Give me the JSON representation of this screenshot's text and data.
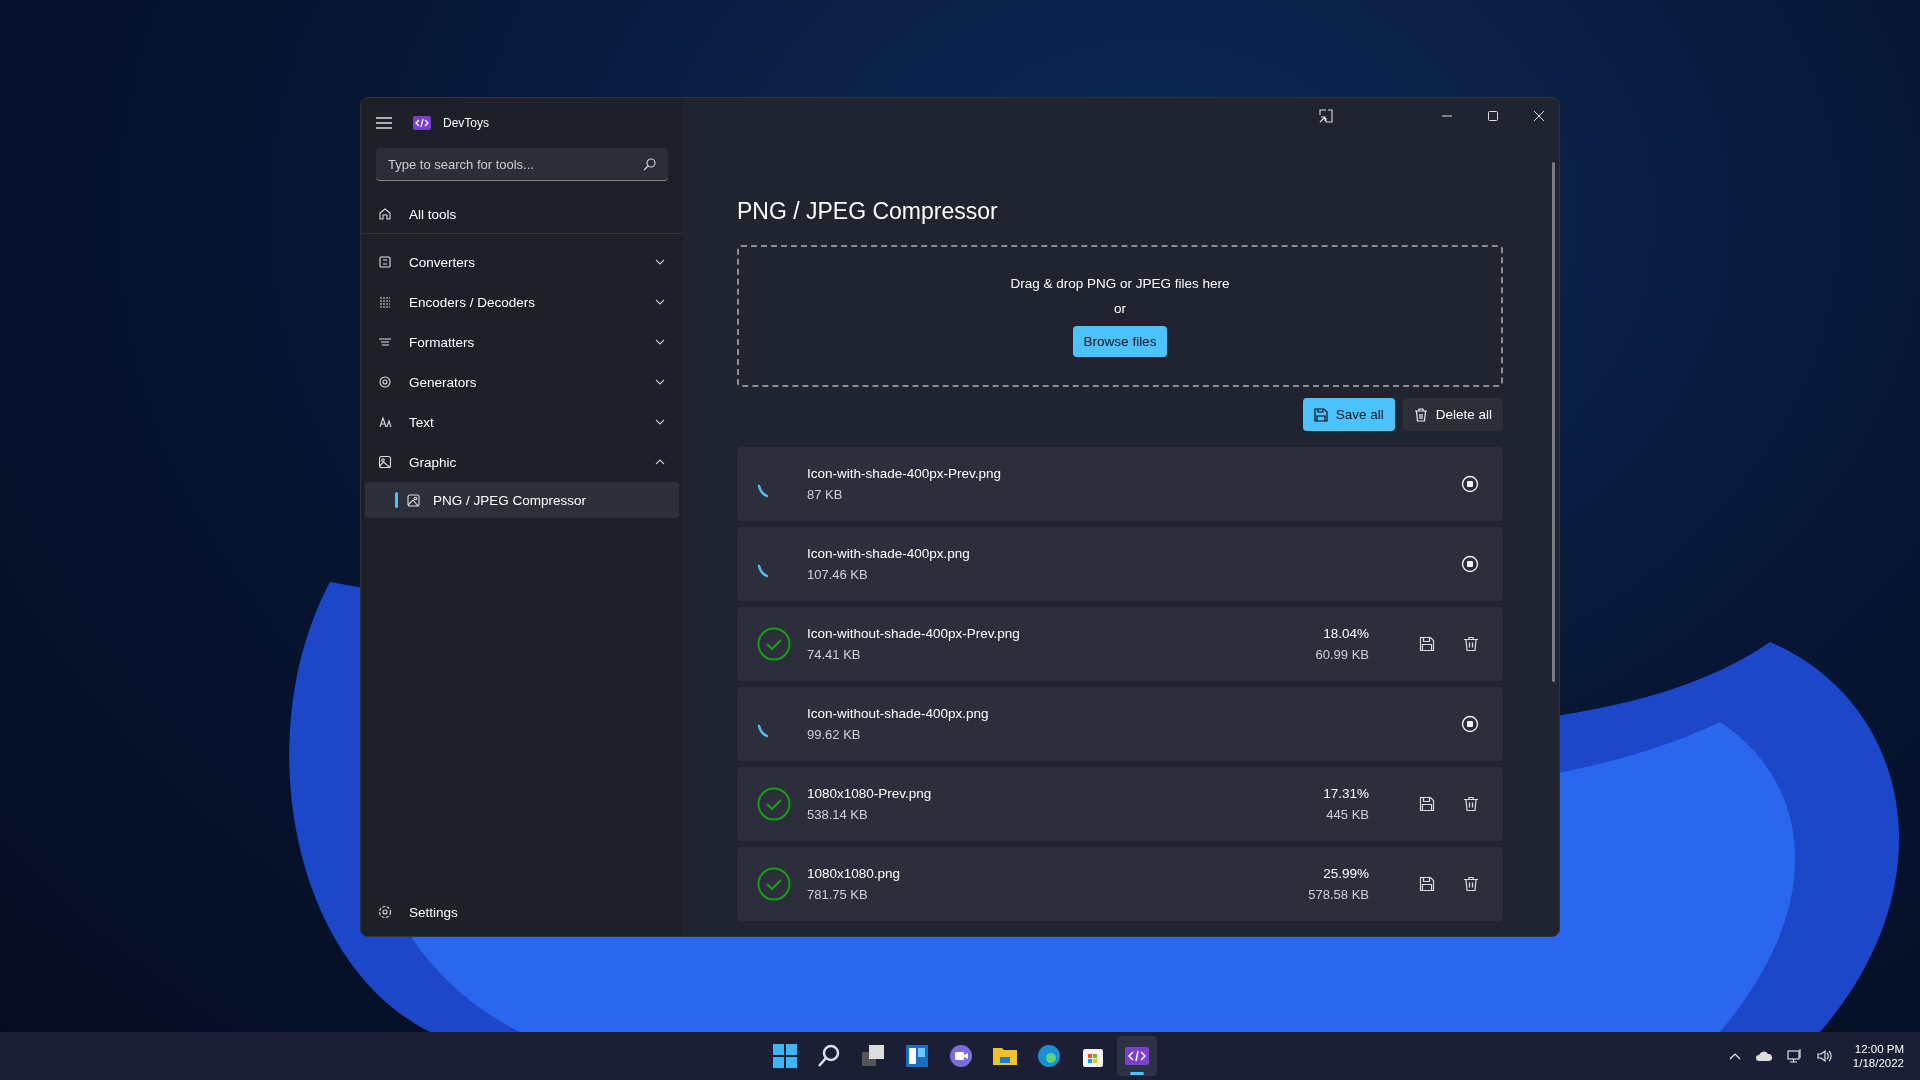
{
  "window": {
    "title": "DevToys"
  },
  "search": {
    "placeholder": "Type to search for tools..."
  },
  "sidebar": {
    "items": [
      {
        "label": "Converters",
        "expanded": false
      },
      {
        "label": "Encoders / Decoders",
        "expanded": false
      },
      {
        "label": "Formatters",
        "expanded": false
      },
      {
        "label": "Generators",
        "expanded": false
      },
      {
        "label": "Text",
        "expanded": false
      },
      {
        "label": "Graphic",
        "expanded": true,
        "children": [
          {
            "label": "PNG / JPEG Compressor",
            "selected": true
          }
        ]
      }
    ],
    "all_tools": "All tools",
    "settings": "Settings"
  },
  "page": {
    "title": "PNG / JPEG Compressor",
    "drop_zone": {
      "text": "Drag & drop PNG or JPEG files here",
      "or": "or",
      "button": "Browse files"
    },
    "actions": [
      {
        "kind": "save",
        "label": "Save all"
      },
      {
        "kind": "delete",
        "label": "Delete all"
      }
    ],
    "files": [
      {
        "kind": "processing",
        "name": "Icon-with-shade-400px-Prev.png",
        "size": "87 KB"
      },
      {
        "kind": "processing",
        "name": "Icon-with-shade-400px.png",
        "size": "107.46 KB"
      },
      {
        "kind": "done",
        "name": "Icon-without-shade-400px-Prev.png",
        "size": "74.41 KB",
        "ratio": "18.04%",
        "new_size": "60.99 KB"
      },
      {
        "kind": "processing",
        "name": "Icon-without-shade-400px.png",
        "size": "99.62 KB"
      },
      {
        "kind": "done",
        "name": "1080x1080-Prev.png",
        "size": "538.14 KB",
        "ratio": "17.31%",
        "new_size": "445 KB"
      },
      {
        "kind": "done",
        "name": "1080x1080.png",
        "size": "781.75 KB",
        "ratio": "25.99%",
        "new_size": "578.58 KB"
      }
    ]
  },
  "taskbar": {
    "apps": [
      {
        "kind": "start",
        "selected": false
      },
      {
        "kind": "search",
        "selected": false
      },
      {
        "kind": "taskview",
        "selected": false
      },
      {
        "kind": "widgets",
        "selected": false
      },
      {
        "kind": "chat",
        "selected": false
      },
      {
        "kind": "explorer",
        "selected": false
      },
      {
        "kind": "edge",
        "selected": false
      },
      {
        "kind": "store",
        "selected": false
      },
      {
        "kind": "devtoys",
        "selected": true
      }
    ],
    "time": "12:00 PM",
    "date": "1/18/2022"
  }
}
